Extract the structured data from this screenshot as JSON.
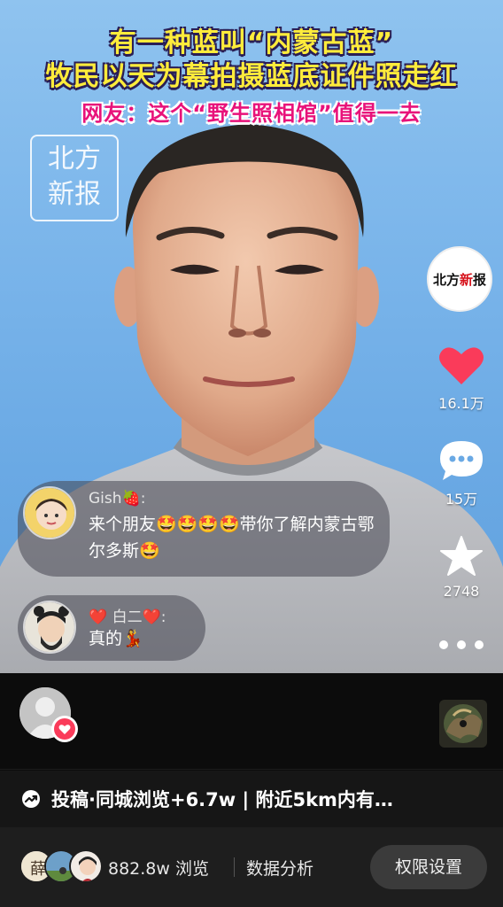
{
  "video": {
    "headline_line1": "有一种蓝叫“内蒙古蓝”",
    "headline_line2": "牧民以天为幕拍摄蓝底证件照走红",
    "headline_line3": "网友：这个“野生照相馆”值得一去",
    "watermark_line1": "北方",
    "watermark_line2": "新报"
  },
  "creator_badge": {
    "text_a": "北方",
    "text_b": "新",
    "text_c": "报"
  },
  "actions": {
    "like_count": "16.1万",
    "comment_count": "15万",
    "favorite_count": "2748",
    "like_color": "#fa3b5a"
  },
  "comments": [
    {
      "name": "Gish🍓:",
      "text": "来个朋友🤩🤩🤩🤩带你了解内蒙古鄂尔多斯🤩"
    },
    {
      "name": "❤️ 白二❤️:",
      "text": "真的💃"
    }
  ],
  "stats": {
    "trend_icon": "trending-icon",
    "text": "投稿·同城浏览+6.7w | 附近5km内有…"
  },
  "bottom": {
    "views": "882.8w 浏览",
    "analysis": "数据分析",
    "permission_button": "权限设置",
    "viewer_avatar_1_text": "薛"
  }
}
